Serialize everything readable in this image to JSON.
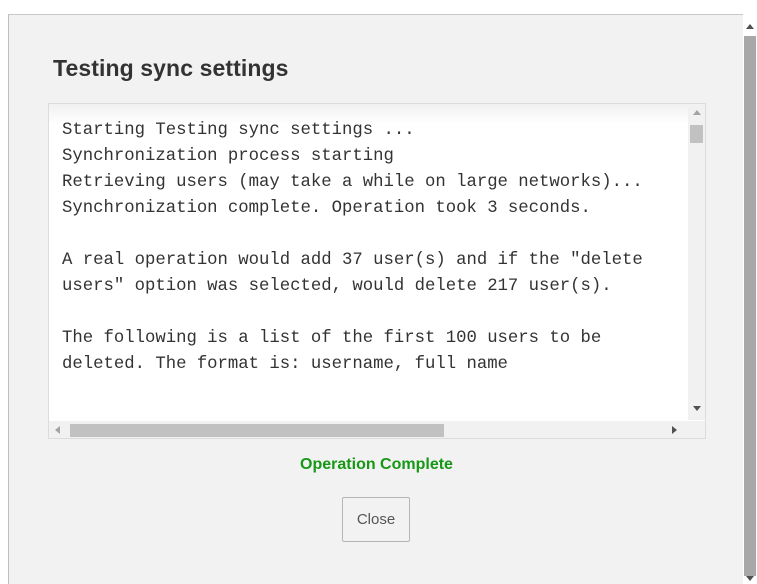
{
  "dialog": {
    "title": "Testing sync settings",
    "log_lines": [
      "Starting Testing sync settings ...",
      "Synchronization process starting",
      "Retrieving users (may take a while on large networks)...",
      "Synchronization complete. Operation took 3 seconds.",
      "",
      "A real operation would add 37 user(s) and if the \"delete users\" option was selected, would delete 217 user(s).",
      "",
      "The following is a list of the first 100 users to be deleted. The format is: username, full name"
    ],
    "status_text": "Operation Complete",
    "status_color": "#169816",
    "close_label": "Close"
  }
}
